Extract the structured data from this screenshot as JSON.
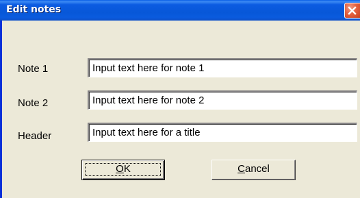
{
  "window": {
    "title": "Edit notes"
  },
  "titlebar": {
    "close_icon": "close-x-icon",
    "close_color": "#E3613F",
    "accent_color": "#0757D8"
  },
  "fields": [
    {
      "label": "Note 1",
      "value": "Input text here for note 1"
    },
    {
      "label": "Note 2",
      "value": "Input text here for note 2"
    },
    {
      "label": "Header",
      "value": "Input text here for a title"
    }
  ],
  "buttons": {
    "ok": {
      "accel": "O",
      "rest": "K"
    },
    "cancel": {
      "accel": "C",
      "rest": "ancel"
    }
  }
}
